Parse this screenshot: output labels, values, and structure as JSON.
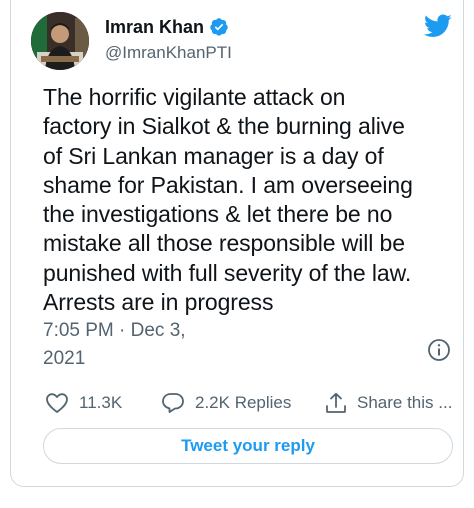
{
  "author": {
    "name": "Imran Khan",
    "handle": "@ImranKhanPTI",
    "verified": true
  },
  "tweet": {
    "text": "The horrific vigilante attack on\nfactory in Sialkot & the burning alive\nof Sri Lankan manager is a day of\nshame for Pakistan. I am overseeing\nthe investigations & let there be no\nmistake all those responsible will be\npunished with full severity of the law.\nArrests are in progress",
    "timestamp": "7:05 PM · Dec 3,\n2021"
  },
  "actions": {
    "likes": "11.3K",
    "replies": "2.2K Replies",
    "share": "Share this ..."
  },
  "reply_button": "Tweet your reply",
  "colors": {
    "accent": "#1d9bf0",
    "text": "#0f1419",
    "secondary": "#536471",
    "border": "#cfd9de"
  },
  "icons": [
    "twitter-bird-icon",
    "verified-badge-icon",
    "info-icon",
    "heart-icon",
    "reply-bubble-icon",
    "share-icon"
  ]
}
